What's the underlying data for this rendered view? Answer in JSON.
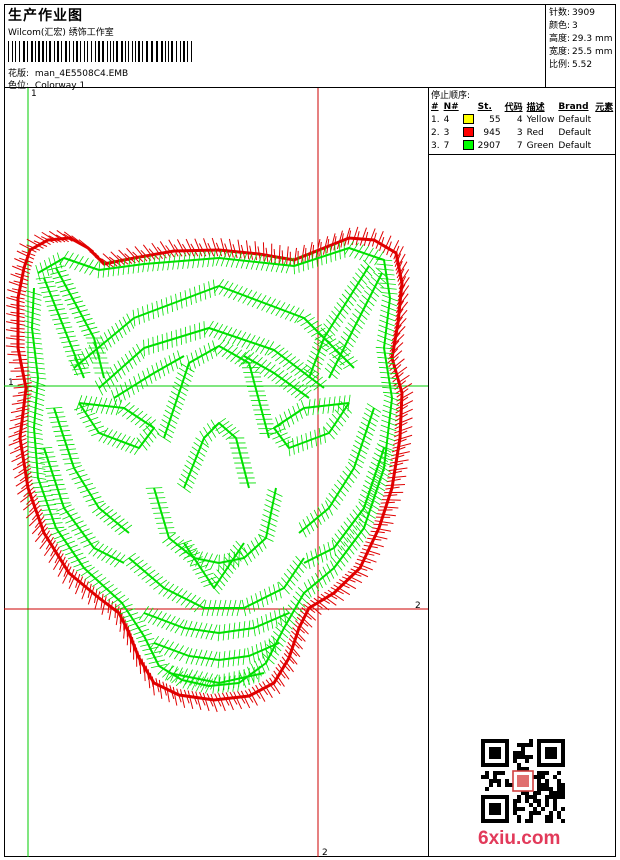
{
  "header": {
    "title": "生产作业图",
    "company": "Wilcom(汇宏) 绣饰工作室",
    "design_label": "花版:",
    "design_value": "man_4E5508C4.EMB",
    "colorway_label": "色位:",
    "colorway_value": "Colorway 1"
  },
  "stats": [
    {
      "label": "针数:",
      "value": "3909"
    },
    {
      "label": "颜色:",
      "value": "3"
    },
    {
      "label": "高度:",
      "value": "29.3 mm"
    },
    {
      "label": "宽度:",
      "value": "25.5 mm"
    },
    {
      "label": "比例:",
      "value": "5.52"
    }
  ],
  "stop_sequence": {
    "title": "停止顺序:",
    "columns": [
      "#",
      "N#",
      "St.",
      "代码",
      "描述",
      "Brand",
      "元素"
    ],
    "rows": [
      {
        "index": "1.",
        "needle": "4",
        "swatch": "#ffff00",
        "stitches": "55",
        "code": "4",
        "description": "Yellow",
        "brand": "Default"
      },
      {
        "index": "2.",
        "needle": "3",
        "swatch": "#ff0000",
        "stitches": "945",
        "code": "3",
        "description": "Red",
        "brand": "Default"
      },
      {
        "index": "3.",
        "needle": "7",
        "swatch": "#00ff00",
        "stitches": "2907",
        "code": "7",
        "description": "Green",
        "brand": "Default"
      }
    ]
  },
  "guides": {
    "green_vertical": "1",
    "green_horizontal": "1",
    "red_vertical": "2",
    "red_horizontal": "2"
  },
  "colors": {
    "green": "#00e000",
    "red": "#e00000"
  },
  "watermark": "6xiu.com"
}
